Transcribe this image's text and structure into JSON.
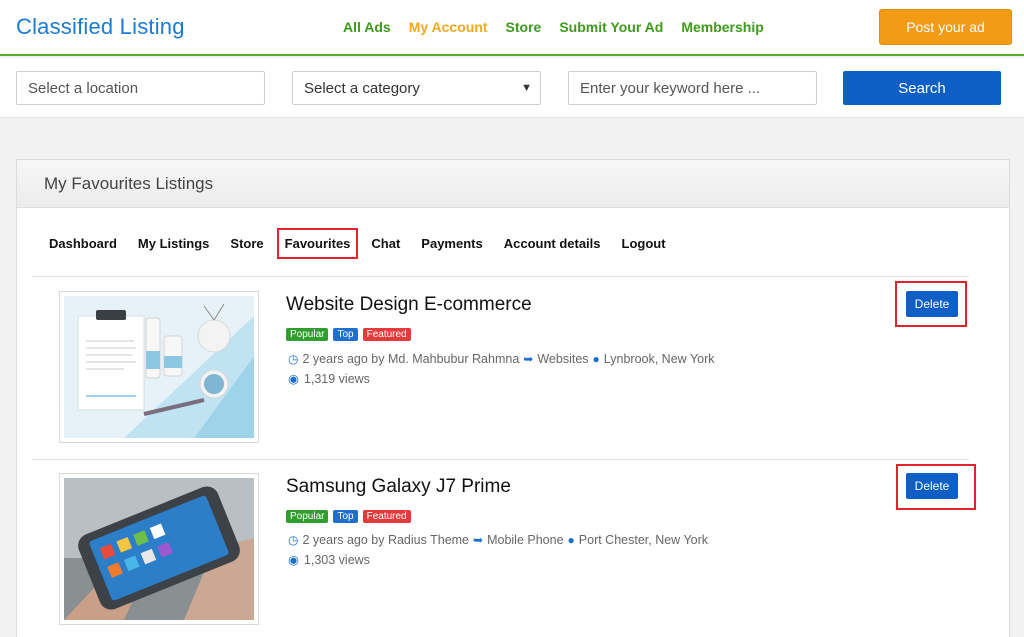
{
  "header": {
    "logo": "Classified Listing",
    "nav": [
      {
        "label": "All Ads",
        "active": false
      },
      {
        "label": "My Account",
        "active": true
      },
      {
        "label": "Store",
        "active": false
      },
      {
        "label": "Submit Your Ad",
        "active": false
      },
      {
        "label": "Membership",
        "active": false
      }
    ],
    "post_button": "Post your ad"
  },
  "search": {
    "location_placeholder": "Select a location",
    "category_value": "Select a category",
    "keyword_placeholder": "Enter your keyword here ...",
    "search_button": "Search"
  },
  "panel": {
    "title": "My Favourites Listings",
    "tabs": [
      "Dashboard",
      "My Listings",
      "Store",
      "Favourites",
      "Chat",
      "Payments",
      "Account details",
      "Logout"
    ],
    "active_tab": "Favourites"
  },
  "listings": [
    {
      "title": "Website Design E-commerce",
      "badges": [
        "Popular",
        "Top",
        "Featured"
      ],
      "posted": "2 years ago by Md. Mahbubur Rahmna",
      "category": "Websites",
      "location": "Lynbrook, New York",
      "views": "1,319 views",
      "delete_label": "Delete"
    },
    {
      "title": "Samsung Galaxy J7 Prime",
      "badges": [
        "Popular",
        "Top",
        "Featured"
      ],
      "posted": "2 years ago by Radius Theme",
      "category": "Mobile Phone",
      "location": "Port Chester, New York",
      "views": "1,303 views",
      "delete_label": "Delete"
    }
  ],
  "colors": {
    "brand_blue": "#1a7bd3",
    "nav_green": "#3d9a1c",
    "nav_active": "#f0a81c",
    "post_button": "#f29c15",
    "primary_button": "#0d5fc6",
    "badge_popular": "#2f9e2f",
    "badge_top": "#1f6fd1",
    "badge_featured": "#e33b3b",
    "highlight_box": "#e0242a"
  },
  "icons": {
    "time": "clock-icon",
    "category": "tag-icon",
    "location": "map-pin-icon",
    "views": "eye-icon",
    "select_arrow": "chevron-down-icon"
  }
}
